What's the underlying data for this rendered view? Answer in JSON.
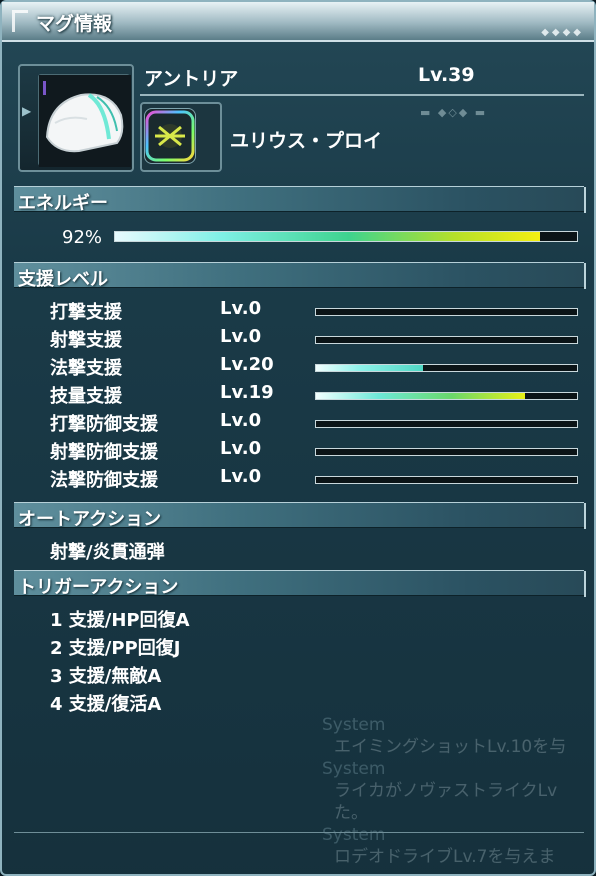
{
  "window": {
    "title": "マグ情報"
  },
  "mag": {
    "name": "アントリア",
    "level": "Lv.39",
    "photon_blast": "ユリウス・プロイ",
    "portrait_icon": "mag-helmet-icon",
    "photon_blast_icon": "photon-blast-icon"
  },
  "energy": {
    "header": "エネルギー",
    "percent_label": "92%",
    "percent_value": 0.92
  },
  "support": {
    "header": "支援レベル",
    "rows": [
      {
        "label": "打撃支援",
        "level": "Lv.0",
        "fill": 0.0,
        "color": "teal"
      },
      {
        "label": "射撃支援",
        "level": "Lv.0",
        "fill": 0.0,
        "color": "teal"
      },
      {
        "label": "法撃支援",
        "level": "Lv.20",
        "fill": 0.41,
        "color": "teal"
      },
      {
        "label": "技量支援",
        "level": "Lv.19",
        "fill": 0.8,
        "color": "yellow"
      },
      {
        "label": "打撃防御支援",
        "level": "Lv.0",
        "fill": 0.0,
        "color": "teal"
      },
      {
        "label": "射撃防御支援",
        "level": "Lv.0",
        "fill": 0.0,
        "color": "teal"
      },
      {
        "label": "法撃防御支援",
        "level": "Lv.0",
        "fill": 0.0,
        "color": "teal"
      }
    ]
  },
  "auto_action": {
    "header": "オートアクション",
    "value": "射撃/炎貫通弾"
  },
  "trigger_action": {
    "header": "トリガーアクション",
    "items": [
      "1 支援/HP回復A",
      "2 支援/PP回復J",
      "3 支援/無敵A",
      "4 支援/復活A"
    ]
  },
  "chat_log": [
    {
      "sender": "System",
      "text": "エイミングショットLv.10を与"
    },
    {
      "sender": "System",
      "text": "ライカがノヴァストライクLv"
    },
    {
      "sender": "",
      "text": "た。"
    },
    {
      "sender": "System",
      "text": "ロデオドライブLv.7を与えま"
    }
  ],
  "colors": {
    "accent": "#5f8f9d",
    "energy_end": "#f4ef12",
    "support_teal": "#4fd7c4",
    "support_yellow": "#e8f015"
  }
}
